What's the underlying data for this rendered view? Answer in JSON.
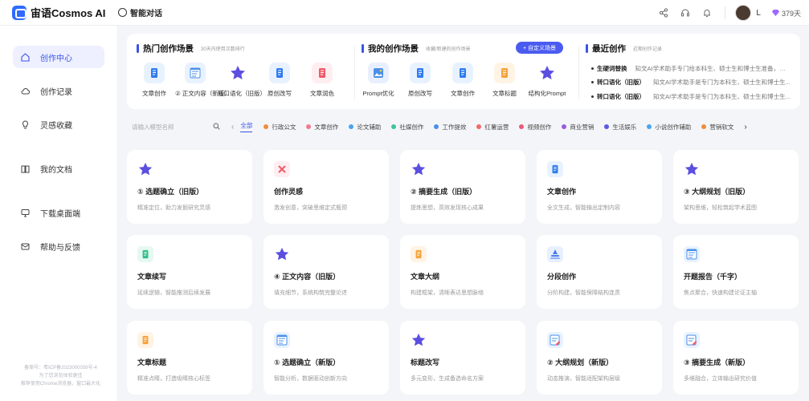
{
  "app": {
    "logo_text": "宙语Cosmos AI",
    "chat_tab": "智能对话"
  },
  "user": {
    "name": "L",
    "days": "379天"
  },
  "sidebar": {
    "items": [
      {
        "label": "创作中心",
        "icon": "home-icon"
      },
      {
        "label": "创作记录",
        "icon": "cloud-icon"
      },
      {
        "label": "灵感收藏",
        "icon": "bulb-icon"
      },
      {
        "label": "我的文档",
        "icon": "book-icon"
      },
      {
        "label": "下载桌面端",
        "icon": "monitor-icon"
      },
      {
        "label": "帮助与反馈",
        "icon": "mail-icon"
      }
    ],
    "footer": [
      "备案号：粤ICP备2023000059号-4",
      "为了您浏览体验更佳",
      "推荐使用Chrome浏览器，窗口最大化"
    ]
  },
  "hot": {
    "title": "热门创作场景",
    "subtitle": "30天内使用次数排行",
    "items": [
      "文章创作",
      "② 正文内容（新版）",
      "转口语化（旧版）",
      "原创改写",
      "文章润色"
    ]
  },
  "mine": {
    "title": "我的创作场景",
    "subtitle": "收藏/新建的创作场景",
    "custom_button": "+ 自定义场景",
    "items": [
      "Prompt优化",
      "原创改写",
      "文章创作",
      "文章标题",
      "结构化Prompt"
    ]
  },
  "recent": {
    "title": "最近创作",
    "subtitle": "近期创作记录",
    "items": [
      {
        "k": "生硬词替换",
        "v": "知文AI学术助手专门给本科生、硕士生和博士生准备，是..."
      },
      {
        "k": "转口语化（旧版）",
        "v": "知文AI学术助手是专门为本科生、硕士生和博士生..."
      },
      {
        "k": "转口语化（旧版）",
        "v": "知文AI学术助手是专门为本科生、硕士生和博士生..."
      }
    ]
  },
  "search": {
    "placeholder": "请输入模型名称"
  },
  "categories": [
    {
      "label": "全部",
      "color": ""
    },
    {
      "label": "行政公文",
      "color": "#f08c3c"
    },
    {
      "label": "文章创作",
      "color": "#f07a8f"
    },
    {
      "label": "论文辅助",
      "color": "#4aa4f0"
    },
    {
      "label": "社媒创作",
      "color": "#3cc3a0"
    },
    {
      "label": "工作提效",
      "color": "#4a90e8"
    },
    {
      "label": "红薯运营",
      "color": "#f06a6a"
    },
    {
      "label": "视频创作",
      "color": "#e85a7a"
    },
    {
      "label": "商业营销",
      "color": "#9b5ae0"
    },
    {
      "label": "生活娱乐",
      "color": "#5a5ae0"
    },
    {
      "label": "小说创作辅助",
      "color": "#4aa4f0"
    },
    {
      "label": "营销软文",
      "color": "#f08c3c"
    }
  ],
  "cards": [
    {
      "title": "① 选题确立（旧版）",
      "desc": "精准定位，助力发掘研究灵感",
      "icon": "star-icon",
      "color": "#eef0ff"
    },
    {
      "title": "创作灵感",
      "desc": "激发创意，突破思维定式瓶颈",
      "icon": "pen-cross-icon",
      "color": "#ffeef0"
    },
    {
      "title": "② 摘要生成（旧版）",
      "desc": "提炼思想，高效发现核心成果",
      "icon": "star-icon",
      "color": "#eef0ff"
    },
    {
      "title": "文章创作",
      "desc": "全文生成，智能输出定制内容",
      "icon": "doc-blue-icon",
      "color": "#e8f2ff"
    },
    {
      "title": "③ 大纲规划（旧版）",
      "desc": "架构思维，轻松筑起学术蓝图",
      "icon": "star-icon",
      "color": "#eef0ff"
    },
    {
      "title": "文章续写",
      "desc": "延续逻辑，智能推测后续发展",
      "icon": "doc-green-icon",
      "color": "#e6f8f1"
    },
    {
      "title": "④ 正文内容（旧版）",
      "desc": "填充细节，系统构筑完整论述",
      "icon": "star-icon",
      "color": "#eef0ff"
    },
    {
      "title": "文章大纲",
      "desc": "构建框架，清晰表达思想脉络",
      "icon": "doc-orange-icon",
      "color": "#fff3e4"
    },
    {
      "title": "分段创作",
      "desc": "分阶构建，智能保障结构连贯",
      "icon": "layers-icon",
      "color": "#e8f0ff"
    },
    {
      "title": "开题报告（千字）",
      "desc": "焦点聚合，快速构建论证主轴",
      "icon": "report-icon",
      "color": "#e8f2ff"
    },
    {
      "title": "文章标题",
      "desc": "精准点睛，打造吸睛核心标签",
      "icon": "doc-orange-icon",
      "color": "#fff3e4"
    },
    {
      "title": "① 选题确立（新版）",
      "desc": "智能分析，数据驱动创新方向",
      "icon": "report-icon",
      "color": "#e8f2ff"
    },
    {
      "title": "标题改写",
      "desc": "多元变形，生成备选命名方案",
      "icon": "star-icon",
      "color": "#eef0ff"
    },
    {
      "title": "② 大纲规划（新版）",
      "desc": "动态推演，智能适配架构层级",
      "icon": "report-edit-icon",
      "color": "#e8f2ff"
    },
    {
      "title": "③ 摘要生成（新版）",
      "desc": "多维融合，立体输出研究价值",
      "icon": "report-edit-icon",
      "color": "#e8f2ff"
    }
  ],
  "colors": {
    "accent": "#3b53e6",
    "button": "#4a5cf0",
    "star": "#5a4fe0"
  }
}
